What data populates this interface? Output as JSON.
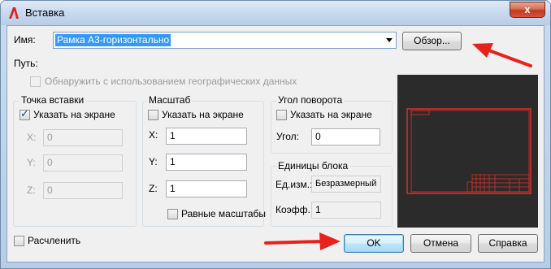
{
  "window": {
    "title": "Вставка",
    "close_label": "x"
  },
  "name_row": {
    "label": "Имя:",
    "value": "Рамка А3-горизонтально",
    "browse_label": "Обзор..."
  },
  "path": {
    "label": "Путь:",
    "geo_checkbox_label": "Обнаружить с использованием географических данных",
    "geo_checked": false
  },
  "insertion_point": {
    "title": "Точка вставки",
    "specify_label": "Указать на экране",
    "specify_checked": true,
    "x_label": "X:",
    "x_value": "0",
    "y_label": "Y:",
    "y_value": "0",
    "z_label": "Z:",
    "z_value": "0"
  },
  "scale": {
    "title": "Масштаб",
    "specify_label": "Указать на экране",
    "specify_checked": false,
    "x_label": "X:",
    "x_value": "1",
    "y_label": "Y:",
    "y_value": "1",
    "z_label": "Z:",
    "z_value": "1",
    "uniform_label": "Равные масштабы",
    "uniform_checked": false
  },
  "rotation": {
    "title": "Угол поворота",
    "specify_label": "Указать на экране",
    "specify_checked": false,
    "angle_label": "Угол:",
    "angle_value": "0"
  },
  "block_units": {
    "title": "Единицы блока",
    "unit_label": "Ед.изм.:",
    "unit_value": "Безразмерный",
    "factor_label": "Коэфф.:",
    "factor_value": "1"
  },
  "explode": {
    "label": "Расчленить",
    "checked": false
  },
  "buttons": {
    "ok": "OK",
    "cancel": "Отмена",
    "help": "Справка"
  },
  "colors": {
    "annotation_arrow": "#e8211d",
    "preview_lines": "#e8312a",
    "preview_bg": "#2b2b2b"
  }
}
